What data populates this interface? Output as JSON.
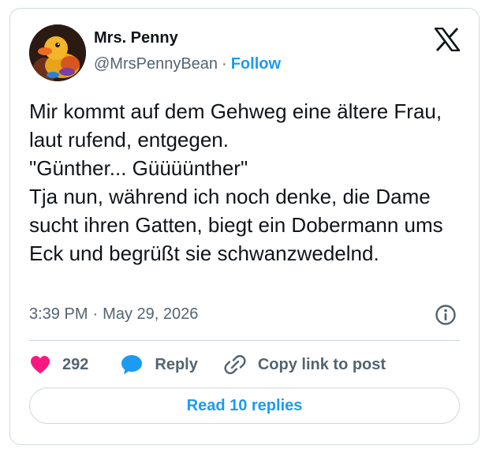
{
  "author": {
    "display_name": "Mrs. Penny",
    "handle": "@MrsPennyBean",
    "separator": "·",
    "follow_label": "Follow"
  },
  "tweet": {
    "text": "Mir kommt auf dem Gehweg eine ältere Frau, laut rufend, entgegen.\n\"Günther... Güüüünther\"\nTja nun, während ich noch denke, die Dame sucht ihren Gatten, biegt ein Dobermann ums Eck und begrüßt sie schwanzwedelnd.",
    "time": "3:39 PM",
    "separator": "·",
    "date": "May 29, 2026"
  },
  "actions": {
    "like_count": "292",
    "reply_label": "Reply",
    "copy_link_label": "Copy link to post"
  },
  "read_replies_label": "Read 10 replies",
  "colors": {
    "accent": "#1d9bf0",
    "like": "#f91880",
    "text": "#0f1419",
    "muted": "#536471",
    "border": "#cfd9de"
  },
  "icons": {
    "brand": "x-logo-icon",
    "info": "info-icon",
    "like": "heart-icon",
    "reply": "speech-bubble-icon",
    "copy_link": "link-icon"
  }
}
